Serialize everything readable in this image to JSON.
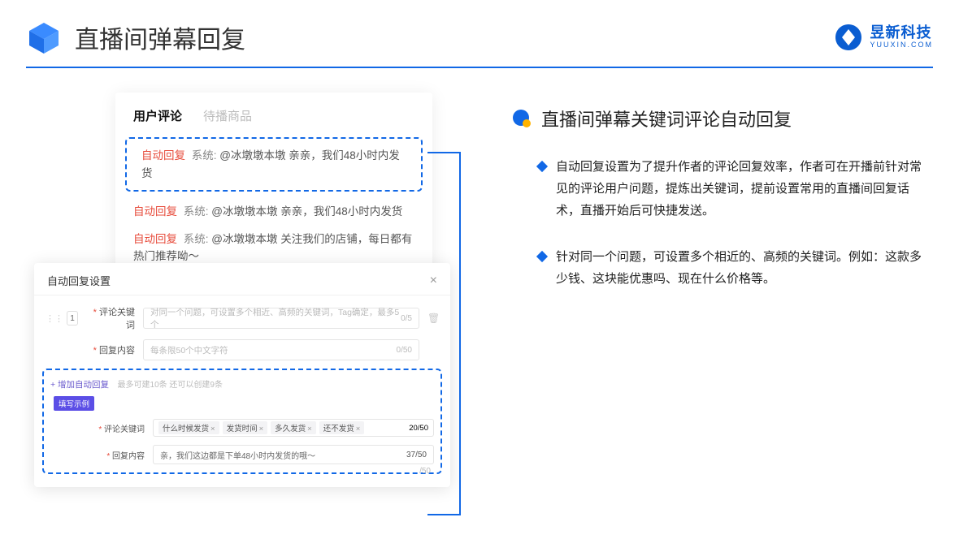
{
  "header": {
    "title": "直播间弹幕回复",
    "brand_cn": "昱新科技",
    "brand_en": "YUUXIN.COM"
  },
  "right": {
    "heading": "直播间弹幕关键词评论自动回复",
    "bullets": [
      "自动回复设置为了提升作者的评论回复效率，作者可在开播前针对常见的评论用户问题，提炼出关键词，提前设置常用的直播间回复话术，直播开始后可快捷发送。",
      "针对同一个问题，可设置多个相近的、高频的关键词。例如：这款多少钱、这块能优惠吗、现在什么价格等。"
    ]
  },
  "comments": {
    "tab_active": "用户评论",
    "tab_inactive": "待播商品",
    "tag_auto": "自动回复",
    "tag_sys": "系统:",
    "lines": [
      "@冰墩墩本墩 亲亲，我们48小时内发货",
      "@冰墩墩本墩 亲亲，我们48小时内发货",
      "@冰墩墩本墩 关注我们的店铺，每日都有热门推荐呦～"
    ]
  },
  "settings": {
    "title": "自动回复设置",
    "order": "1",
    "label_keyword": "评论关键词",
    "placeholder_keyword": "对同一个问题，可设置多个相近、高频的关键词，Tag确定，最多5个",
    "count_keyword": "0/5",
    "label_content": "回复内容",
    "placeholder_content": "每条限50个中文字符",
    "count_content": "0/50",
    "add_link": "+ 增加自动回复",
    "add_note": "最多可建10条 还可以创建9条",
    "badge": "填写示例",
    "example": {
      "label_keyword": "评论关键词",
      "chips": [
        "什么时候发货",
        "发货时间",
        "多久发货",
        "还不发货"
      ],
      "count_keyword": "20/50",
      "label_content": "回复内容",
      "content_text": "亲，我们这边都是下单48小时内发货的哦～",
      "count_content": "37/50"
    },
    "floating_count": "/50"
  }
}
